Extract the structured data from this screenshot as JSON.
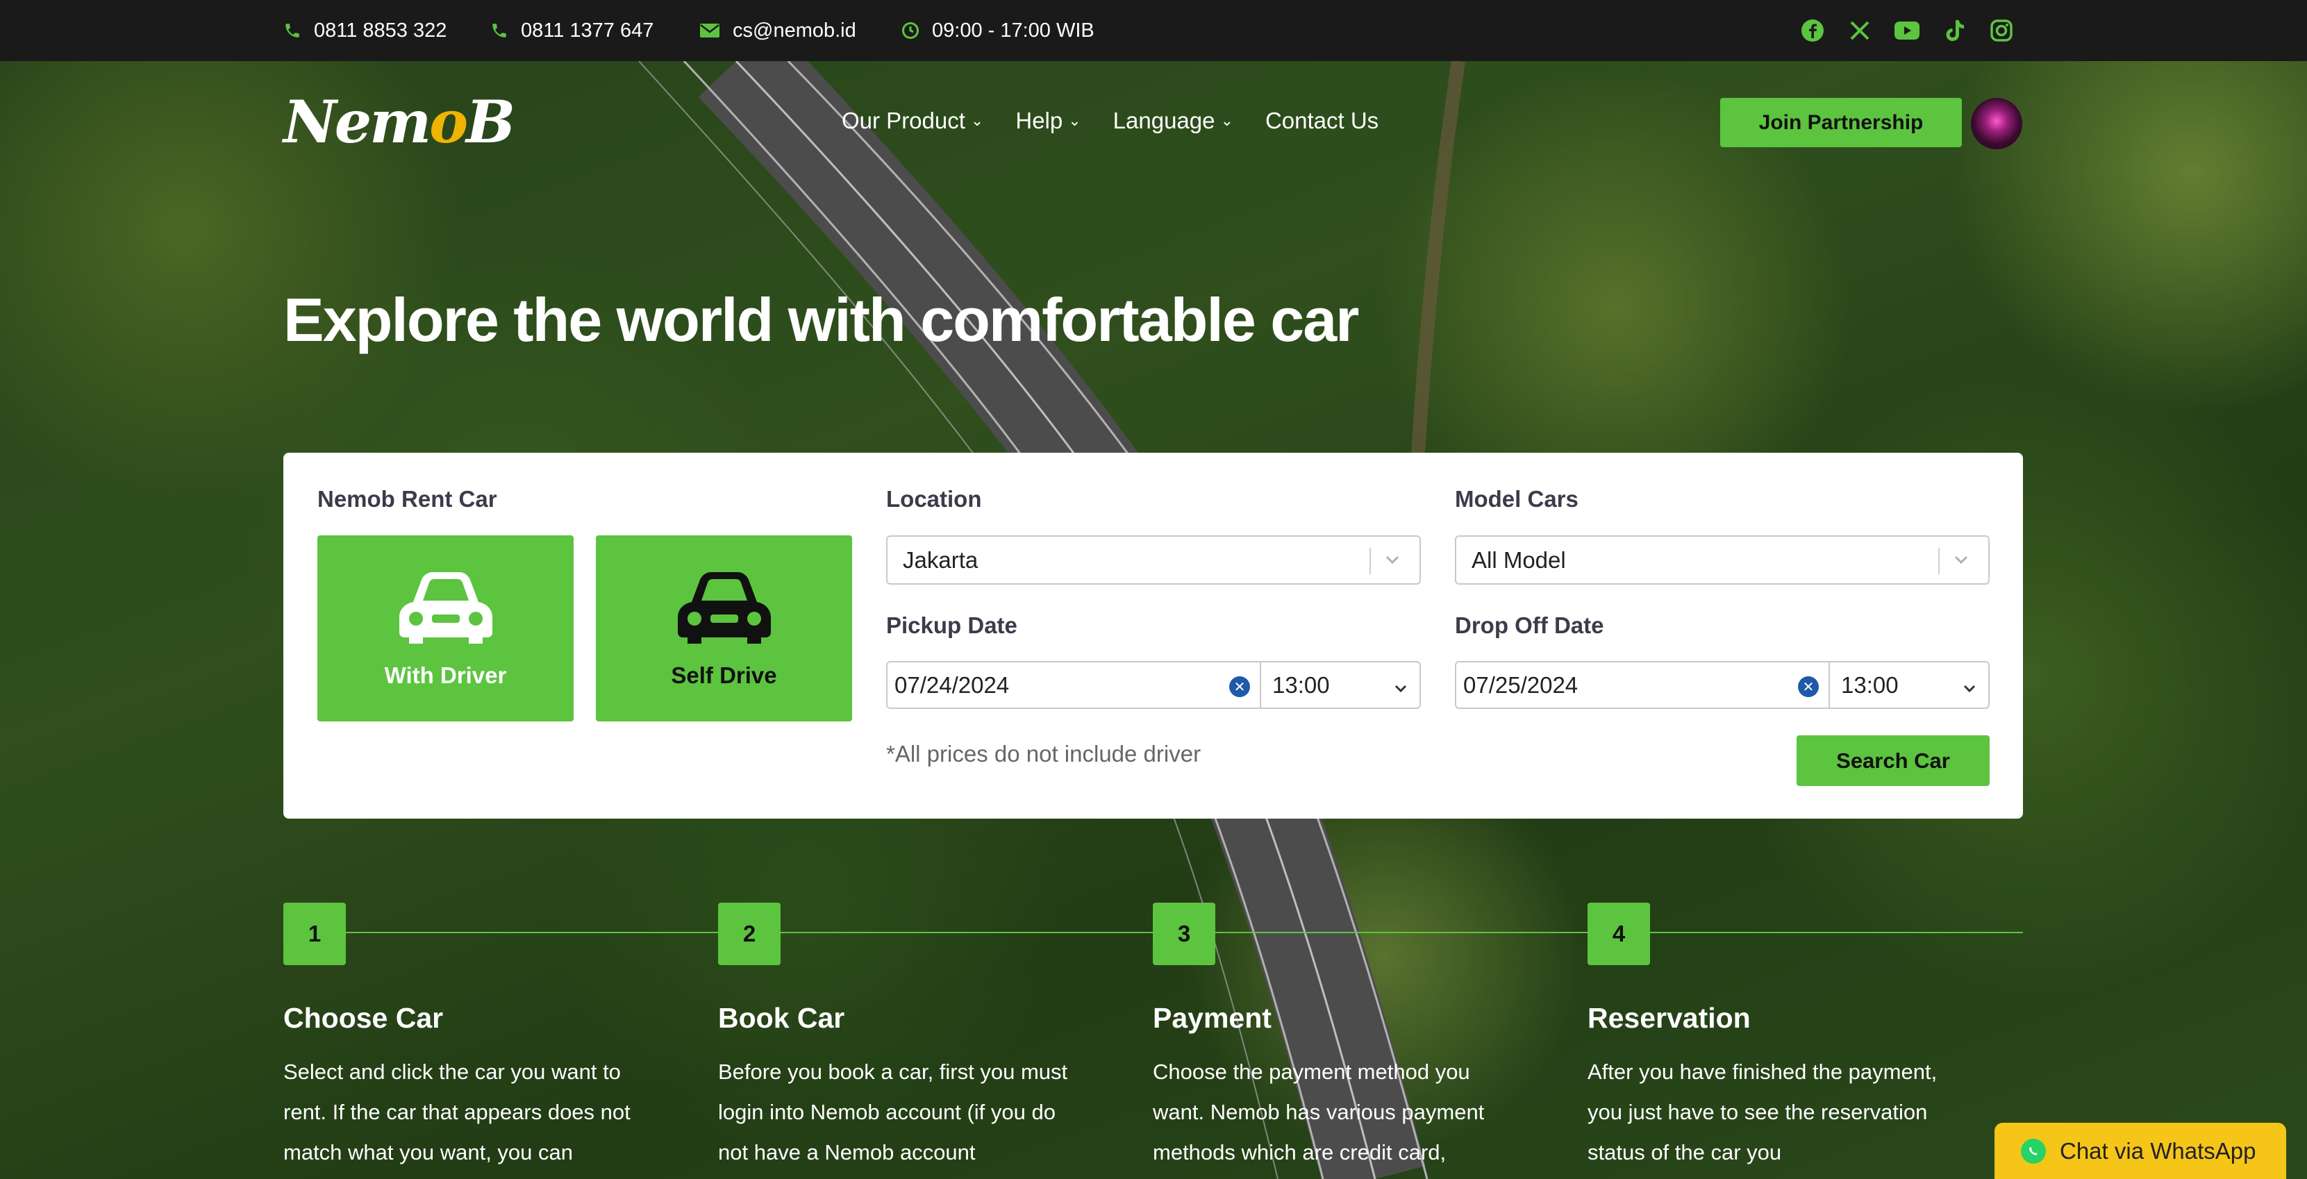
{
  "topbar": {
    "phone1": "0811 8853 322",
    "phone2": "0811 1377 647",
    "email": "cs@nemob.id",
    "hours": "09:00 - 17:00 WIB",
    "social": [
      "facebook-icon",
      "x-icon",
      "youtube-icon",
      "tiktok-icon",
      "instagram-icon"
    ]
  },
  "brand": {
    "logo_text_a": "Nem",
    "logo_text_b": "o",
    "logo_text_c": "B"
  },
  "nav": {
    "items": [
      {
        "label": "Our Product",
        "has_dropdown": true
      },
      {
        "label": "Help",
        "has_dropdown": true
      },
      {
        "label": "Language",
        "has_dropdown": true
      },
      {
        "label": "Contact Us",
        "has_dropdown": false
      }
    ],
    "join_label": "Join Partnership"
  },
  "hero": {
    "title": "Explore the world with comfortable car"
  },
  "search": {
    "rent_label": "Nemob Rent Car",
    "with_driver": "With Driver",
    "self_drive": "Self Drive",
    "location_label": "Location",
    "location_value": "Jakarta",
    "model_label": "Model Cars",
    "model_value": "All Model",
    "pickup_label": "Pickup Date",
    "pickup_date": "07/24/2024",
    "pickup_time": "13:00",
    "dropoff_label": "Drop Off Date",
    "dropoff_date": "07/25/2024",
    "dropoff_time": "13:00",
    "note": "*All prices do not include driver",
    "search_label": "Search Car"
  },
  "steps": [
    {
      "num": "1",
      "title": "Choose Car",
      "desc": "Select and click the car you want to rent. If the car that appears does not match what you want, you can"
    },
    {
      "num": "2",
      "title": "Book Car",
      "desc": "Before you book a car, first you must login into Nemob account (if you do not have a Nemob account"
    },
    {
      "num": "3",
      "title": "Payment",
      "desc": "Choose the payment method you want. Nemob has various payment methods which are credit card,"
    },
    {
      "num": "4",
      "title": "Reservation",
      "desc": "After you have finished the payment, you just have to see the reservation status of the car you"
    }
  ],
  "whatsapp": {
    "label": "Chat via WhatsApp"
  },
  "colors": {
    "accent": "#5cc43f",
    "topbar": "#1a1a1a",
    "whatsapp_btn": "#f5c518"
  }
}
